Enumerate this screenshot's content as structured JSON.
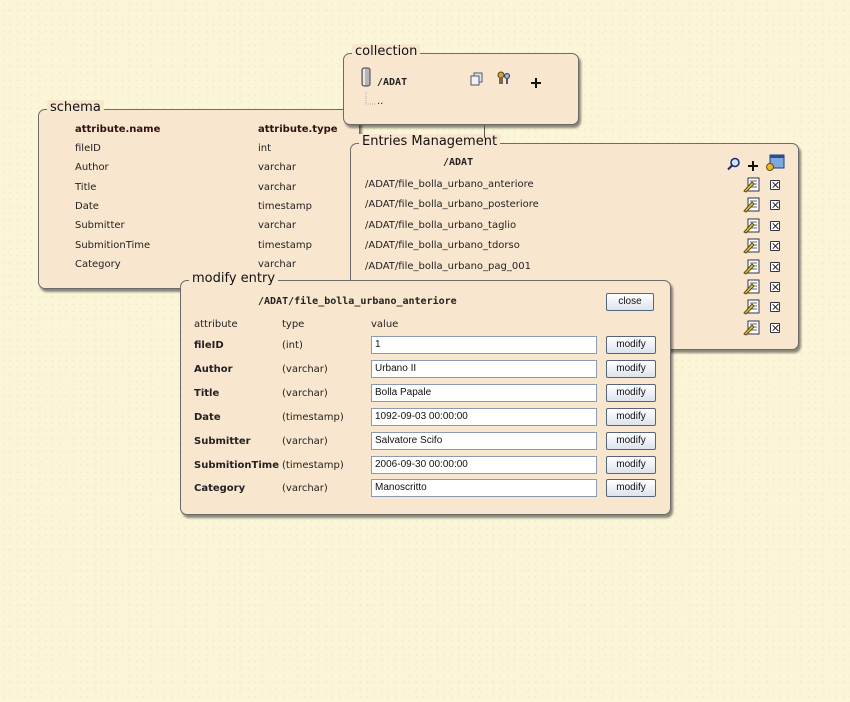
{
  "collection": {
    "legend": "collection",
    "path": "/ADAT",
    "parent": ".."
  },
  "schema": {
    "legend": "schema",
    "headers": {
      "name": "attribute.name",
      "type": "attribute.type"
    },
    "rows": [
      {
        "name": "fileID",
        "type": "int"
      },
      {
        "name": "Author",
        "type": "varchar"
      },
      {
        "name": "Title",
        "type": "varchar"
      },
      {
        "name": "Date",
        "type": "timestamp"
      },
      {
        "name": "Submitter",
        "type": "varchar"
      },
      {
        "name": "SubmitionTime",
        "type": "timestamp"
      },
      {
        "name": "Category",
        "type": "varchar"
      }
    ]
  },
  "entries": {
    "legend": "Entries Management",
    "path": "/ADAT",
    "items": [
      "/ADAT/file_bolla_urbano_anteriore",
      "/ADAT/file_bolla_urbano_posteriore",
      "/ADAT/file_bolla_urbano_taglio",
      "/ADAT/file_bolla_urbano_tdorso",
      "/ADAT/file_bolla_urbano_pag_001"
    ]
  },
  "modify": {
    "legend": "modify entry",
    "path": "/ADAT/file_bolla_urbano_anteriore",
    "close_label": "close",
    "headers": {
      "attribute": "attribute",
      "type": "type",
      "value": "value"
    },
    "modify_label": "modify",
    "rows": [
      {
        "attribute": "fileID",
        "type": "(int)",
        "value": "1"
      },
      {
        "attribute": "Author",
        "type": "(varchar)",
        "value": "Urbano II"
      },
      {
        "attribute": "Title",
        "type": "(varchar)",
        "value": "Bolla Papale"
      },
      {
        "attribute": "Date",
        "type": "(timestamp)",
        "value": "1092-09-03 00:00:00"
      },
      {
        "attribute": "Submitter",
        "type": "(varchar)",
        "value": "Salvatore Scifo"
      },
      {
        "attribute": "SubmitionTime",
        "type": "(timestamp)",
        "value": "2006-09-30 00:00:00"
      },
      {
        "attribute": "Category",
        "type": "(varchar)",
        "value": "Manoscritto"
      }
    ]
  }
}
